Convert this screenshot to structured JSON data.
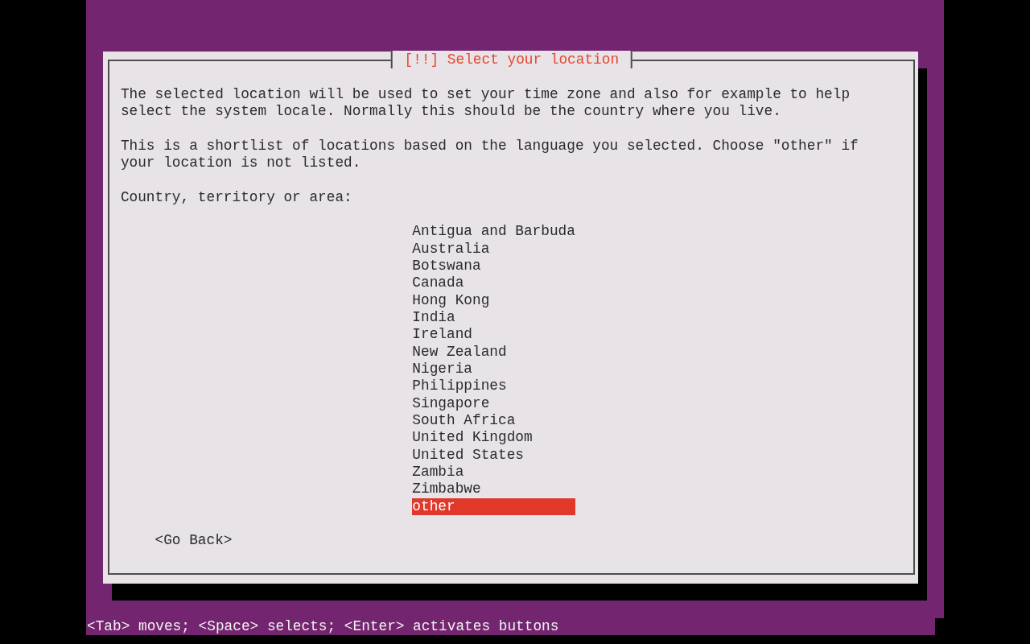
{
  "dialog": {
    "title": "[!!] Select your location",
    "paragraphs": [
      "The selected location will be used to set your time zone and also for example to help select the system locale. Normally this should be the country where you live.",
      "This is a shortlist of locations based on the language you selected. Choose \"other\" if your location is not listed."
    ],
    "prompt": "Country, territory or area:",
    "countries": [
      {
        "label": "Antigua and Barbuda",
        "selected": false
      },
      {
        "label": "Australia",
        "selected": false
      },
      {
        "label": "Botswana",
        "selected": false
      },
      {
        "label": "Canada",
        "selected": false
      },
      {
        "label": "Hong Kong",
        "selected": false
      },
      {
        "label": "India",
        "selected": false
      },
      {
        "label": "Ireland",
        "selected": false
      },
      {
        "label": "New Zealand",
        "selected": false
      },
      {
        "label": "Nigeria",
        "selected": false
      },
      {
        "label": "Philippines",
        "selected": false
      },
      {
        "label": "Singapore",
        "selected": false
      },
      {
        "label": "South Africa",
        "selected": false
      },
      {
        "label": "United Kingdom",
        "selected": false
      },
      {
        "label": "United States",
        "selected": false
      },
      {
        "label": "Zambia",
        "selected": false
      },
      {
        "label": "Zimbabwe",
        "selected": false
      },
      {
        "label": "other",
        "selected": true
      }
    ],
    "back_button": "<Go Back>"
  },
  "status_bar": "<Tab> moves; <Space> selects; <Enter> activates buttons"
}
